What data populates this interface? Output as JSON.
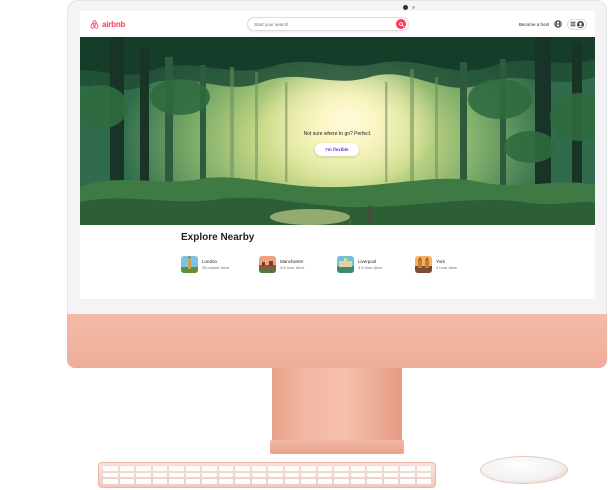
{
  "app": {
    "brand": "airbnb",
    "brand_color": "#FF385C"
  },
  "header": {
    "search_placeholder": "Start your search",
    "become_host": "Become a host",
    "icons": [
      "airbnb-logo-icon",
      "search-icon",
      "globe-icon",
      "menu-icon",
      "user-icon"
    ]
  },
  "hero": {
    "tagline": "Not sure where to go? Perfect.",
    "cta_label": "I'm flexible",
    "cta_color": "#6E2BD9"
  },
  "explore": {
    "title": "Explore Nearby",
    "items": [
      {
        "city": "London",
        "distance": "45 minute drive",
        "thumb_colors": [
          "#7cc1e6",
          "#5e8f3a",
          "#c9a24a"
        ]
      },
      {
        "city": "Manchester",
        "distance": "4.5 hour drive",
        "thumb_colors": [
          "#f0a37a",
          "#8a5a44",
          "#4b7d3c"
        ]
      },
      {
        "city": "Liverpool",
        "distance": "4.5 hour drive",
        "thumb_colors": [
          "#6fc3d2",
          "#3c8c6b",
          "#e3d2a3"
        ]
      },
      {
        "city": "York",
        "distance": "4 hour drive",
        "thumb_colors": [
          "#f2b45c",
          "#c97a3e",
          "#7a4f36"
        ]
      }
    ]
  },
  "device": {
    "chassis_color": "#F4BBA8"
  }
}
